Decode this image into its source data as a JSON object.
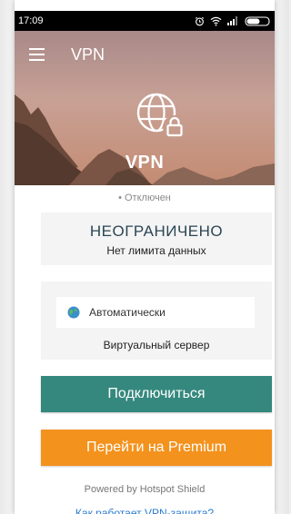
{
  "status_bar": {
    "time": "17:09",
    "icons": [
      "alarm-icon",
      "wifi-icon",
      "signal-icon",
      "battery-icon"
    ]
  },
  "app_bar": {
    "title": "VPN",
    "menu_icon": "hamburger-menu-icon"
  },
  "hero": {
    "icon": "globe-lock-icon",
    "title": "VPN"
  },
  "connection": {
    "status": "• Отключен"
  },
  "data_limit": {
    "headline": "НЕОГРАНИЧЕНО",
    "subtitle": "Нет лимита данных"
  },
  "server": {
    "selected": "Автоматически",
    "icon": "globe-icon",
    "caption": "Виртуальный сервер"
  },
  "buttons": {
    "connect": "Подключиться",
    "premium": "Перейти на Premium"
  },
  "footer": {
    "powered_by": "Powered by Hotspot Shield",
    "how_it_works": "Как работает VPN-защита?"
  },
  "colors": {
    "connect": "#35887d",
    "premium": "#f3921d",
    "link": "#2a7ccf",
    "headline": "#2b4654"
  }
}
